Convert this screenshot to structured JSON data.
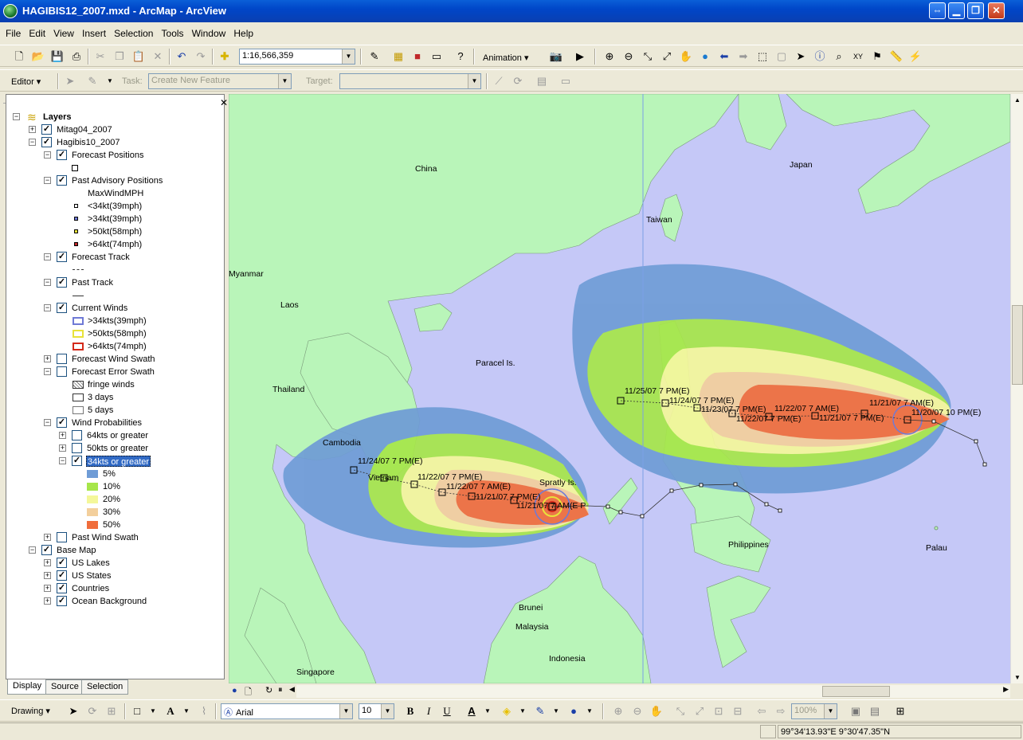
{
  "window": {
    "title": "HAGIBIS12_2007.mxd - ArcMap - ArcView",
    "buttons": [
      "⇔",
      "▁",
      "❐",
      "✕"
    ]
  },
  "menu": [
    "File",
    "Edit",
    "View",
    "Insert",
    "Selection",
    "Tools",
    "Window",
    "Help"
  ],
  "toolbar": {
    "scale": "1:16,566,359",
    "animation_label": "Animation ▾"
  },
  "editor": {
    "label": "Editor ▾",
    "task_label": "Task:",
    "task_value": "Create New Feature",
    "target_label": "Target:"
  },
  "toc": {
    "root": "Layers",
    "items": {
      "mitag": "Mitag04_2007",
      "hagibis": "Hagibis10_2007",
      "forecast_positions": "Forecast Positions",
      "past_advisory": "Past Advisory Positions",
      "maxwind": "MaxWindMPH",
      "adv1": "<34kt(39mph)",
      "adv2": ">34kt(39mph)",
      "adv3": ">50kt(58mph)",
      "adv4": ">64kt(74mph)",
      "forecast_track": "Forecast Track",
      "past_track": "Past Track",
      "current_winds": "Current Winds",
      "cw1": ">34kts(39mph)",
      "cw2": ">50kts(58mph)",
      "cw3": ">64kts(74mph)",
      "forecast_wind_swath": "Forecast Wind Swath",
      "forecast_error_swath": "Forecast Error Swath",
      "fringe": "fringe winds",
      "days3": "3 days",
      "days5": "5 days",
      "wind_prob": "Wind Probabilities",
      "wp64": "64kts or greater",
      "wp50": "50kts or greater",
      "wp34": "34kts or greater",
      "p5": "5%",
      "p10": "10%",
      "p20": "20%",
      "p30": "30%",
      "p50": "50%",
      "past_wind_swath": "Past Wind Swath",
      "base_map": "Base Map",
      "us_lakes": "US Lakes",
      "us_states": "US States",
      "countries": "Countries",
      "ocean": "Ocean Background"
    },
    "tabs": [
      "Display",
      "Source",
      "Selection"
    ]
  },
  "colors": {
    "ocean": "#c5c8f7",
    "land": "#b9f5b9",
    "p5": "#6f9cd6",
    "p10": "#a6e64a",
    "p20": "#f4f79a",
    "p30": "#f3cf9c",
    "p50": "#f06d3b"
  },
  "map": {
    "places": [
      "China",
      "Japan",
      "Taiwan",
      "Myanmar",
      "Laos",
      "Thailand",
      "Cambodia",
      "Vietnam",
      "Paracel Is.",
      "Spratly Is.",
      "Philippines",
      "Palau",
      "Brunei",
      "Malaysia",
      "Indonesia",
      "Singapore"
    ],
    "track_labels": [
      "11/25/07 7 PM(E)",
      "11/24/07 7 PM(E)",
      "11/23/07 7 PM(E)",
      "11/22/07 7 PM(E)",
      "11/22/07 7 AM(E)",
      "11/21/07 7 PM(E)",
      "11/21/07 7 AM(E)",
      "11/20/07 10 PM(E)",
      "11/24/07 7 PM(E)",
      "11/22/07 7 PM(E)",
      "11/22/07 7 AM(E)",
      "11/21/07 7 PM(E)",
      "11/21/07 7 AM(E P"
    ]
  },
  "drawing": {
    "label": "Drawing ▾",
    "font": "Arial",
    "size": "10",
    "zoom": "100%"
  },
  "status": {
    "coords": "99°34'13.93\"E  9°30'47.35\"N"
  }
}
